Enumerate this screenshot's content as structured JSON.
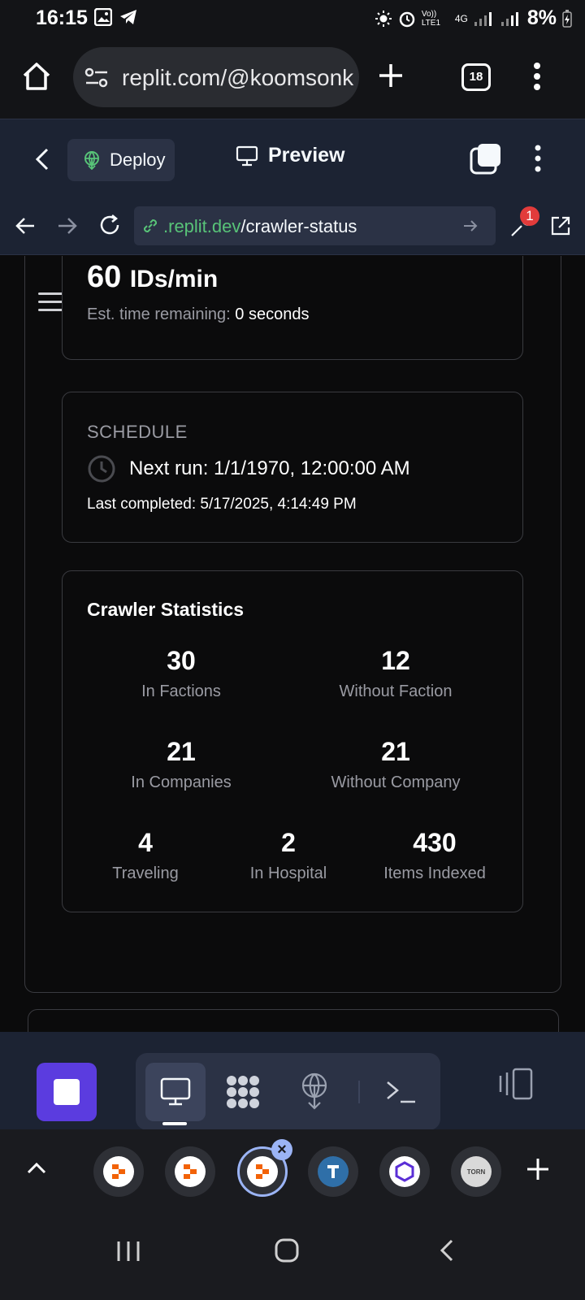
{
  "status_bar": {
    "time": "16:15",
    "network": "4G",
    "signal_label": "Vo)) LTE1",
    "battery": "8%"
  },
  "browser": {
    "url": "replit.com/@koomsonk",
    "tab_count": "18"
  },
  "replit_header": {
    "deploy_label": "Deploy",
    "preview_label": "Preview"
  },
  "devtools_bar": {
    "url_domain": ".replit.dev",
    "url_path": "/crawler-status",
    "notification_count": "1"
  },
  "rate_card": {
    "rate_value": "60",
    "rate_unit": "IDs/min",
    "est_label": "Est. time remaining:",
    "est_value": "0 seconds"
  },
  "schedule_card": {
    "heading": "SCHEDULE",
    "next_run": "Next run: 1/1/1970, 12:00:00 AM",
    "last_label": "Last completed:",
    "last_value": "5/17/2025, 4:14:49 PM"
  },
  "stats_card": {
    "title": "Crawler Statistics",
    "stats": [
      {
        "value": "30",
        "label": "In Factions"
      },
      {
        "value": "12",
        "label": "Without Faction"
      },
      {
        "value": "21",
        "label": "In Companies"
      },
      {
        "value": "21",
        "label": "Without Company"
      },
      {
        "value": "4",
        "label": "Traveling"
      },
      {
        "value": "2",
        "label": "In Hospital"
      },
      {
        "value": "430",
        "label": "Items Indexed"
      }
    ]
  },
  "tab_strip": {
    "tab_icon_label": "TORN"
  },
  "colors": {
    "accent_purple": "#5b3cdf",
    "link_green": "#58c378",
    "badge_red": "#e23b3b",
    "panel_bg": "#1c2333"
  }
}
